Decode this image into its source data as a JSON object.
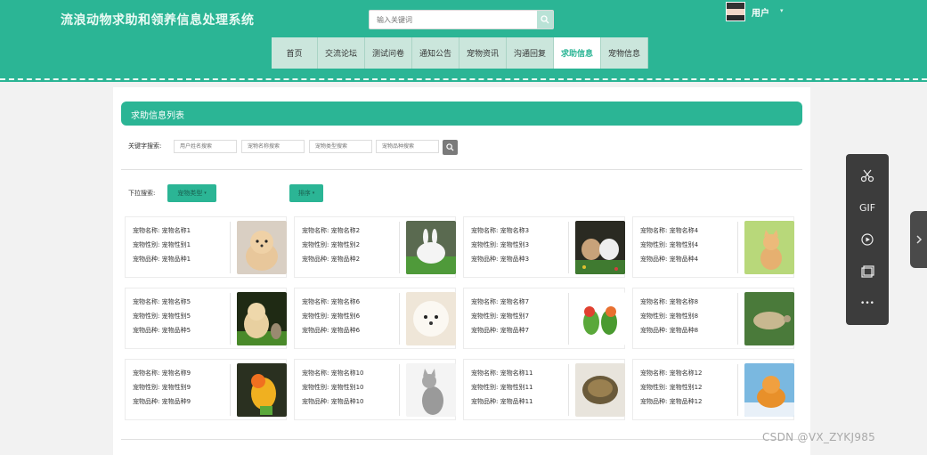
{
  "header": {
    "site_title": "流浪动物求助和领养信息处理系统",
    "search_placeholder": "输入关键词",
    "user_name": "用户",
    "user_caret": "▾"
  },
  "nav": {
    "items": [
      {
        "label": "首页"
      },
      {
        "label": "交流论坛"
      },
      {
        "label": "测试问卷"
      },
      {
        "label": "通知公告"
      },
      {
        "label": "宠物资讯"
      },
      {
        "label": "沟通回复"
      },
      {
        "label": "求助信息",
        "active": true
      },
      {
        "label": "宠物信息"
      }
    ]
  },
  "list": {
    "title": "求助信息列表",
    "keyword_label": "关键字搜索:",
    "keyword_placeholders": [
      "用户姓名搜索",
      "宠物名称搜索",
      "宠物类型搜索",
      "宠物品种搜索"
    ],
    "dropdown_label": "下拉搜索:",
    "pet_type_btn": "宠物类型",
    "sort_btn": "排序",
    "caret": "▾"
  },
  "cards": [
    {
      "name": "宠物名称: 宠物名称1",
      "gender": "宠物性别: 宠物性别1",
      "breed": "宠物品种: 宠物品种1",
      "img": "dog-icon"
    },
    {
      "name": "宠物名称: 宠物名称2",
      "gender": "宠物性别: 宠物性别2",
      "breed": "宠物品种: 宠物品种2",
      "img": "rabbit-icon"
    },
    {
      "name": "宠物名称: 宠物名称3",
      "gender": "宠物性别: 宠物性别3",
      "breed": "宠物品种: 宠物品种3",
      "img": "rabbits-icon"
    },
    {
      "name": "宠物名称: 宠物名称4",
      "gender": "宠物性别: 宠物性别4",
      "breed": "宠物品种: 宠物品种4",
      "img": "kitten-icon"
    },
    {
      "name": "宠物名称: 宠物名称5",
      "gender": "宠物性别: 宠物性别5",
      "breed": "宠物品种: 宠物品种5",
      "img": "puppy-icon"
    },
    {
      "name": "宠物名称: 宠物名称6",
      "gender": "宠物性别: 宠物性别6",
      "breed": "宠物品种: 宠物品种6",
      "img": "white-dog-icon"
    },
    {
      "name": "宠物名称: 宠物名称7",
      "gender": "宠物性别: 宠物性别7",
      "breed": "宠物品种: 宠物品种7",
      "img": "parrots-icon"
    },
    {
      "name": "宠物名称: 宠物名称8",
      "gender": "宠物性别: 宠物性别8",
      "breed": "宠物品种: 宠物品种8",
      "img": "turtle-icon"
    },
    {
      "name": "宠物名称: 宠物名称9",
      "gender": "宠物性别: 宠物性别9",
      "breed": "宠物品种: 宠物品种9",
      "img": "bird-icon"
    },
    {
      "name": "宠物名称: 宠物名称10",
      "gender": "宠物性别: 宠物性别10",
      "breed": "宠物品种: 宠物品种10",
      "img": "cat-icon"
    },
    {
      "name": "宠物名称: 宠物名称11",
      "gender": "宠物性别: 宠物性别11",
      "breed": "宠物品种: 宠物品种11",
      "img": "tortoise-icon"
    },
    {
      "name": "宠物名称: 宠物名称12",
      "gender": "宠物性别: 宠物性别12",
      "breed": "宠物品种: 宠物品种12",
      "img": "orange-cat-icon"
    }
  ],
  "toolbar": {
    "gif_label": "GIF",
    "more_label": "•••"
  },
  "watermark": "CSDN @VX_ZYKJ985",
  "colors": {
    "brand": "#2bb595",
    "nav_bg": "#cbe6dc"
  }
}
